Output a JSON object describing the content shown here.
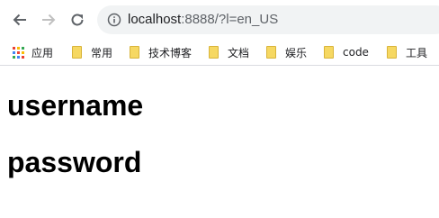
{
  "browser": {
    "url_host": "localhost",
    "url_rest": ":8888/?l=en_US",
    "bookmarks": [
      {
        "label": "应用",
        "icon": "apps-icon"
      },
      {
        "label": "常用",
        "icon": "folder-icon"
      },
      {
        "label": "技术博客",
        "icon": "folder-icon"
      },
      {
        "label": "文档",
        "icon": "folder-icon"
      },
      {
        "label": "娱乐",
        "icon": "folder-icon"
      },
      {
        "label": "code",
        "icon": "folder-icon"
      },
      {
        "label": "工具",
        "icon": "folder-icon"
      }
    ],
    "colors": {
      "omnibox_bg": "#f1f3f4",
      "folder_yellow": "#f6d862",
      "icon_gray": "#5f6368",
      "icon_disabled": "#c0c0c0"
    }
  },
  "page": {
    "headings": [
      "username",
      "password"
    ]
  }
}
